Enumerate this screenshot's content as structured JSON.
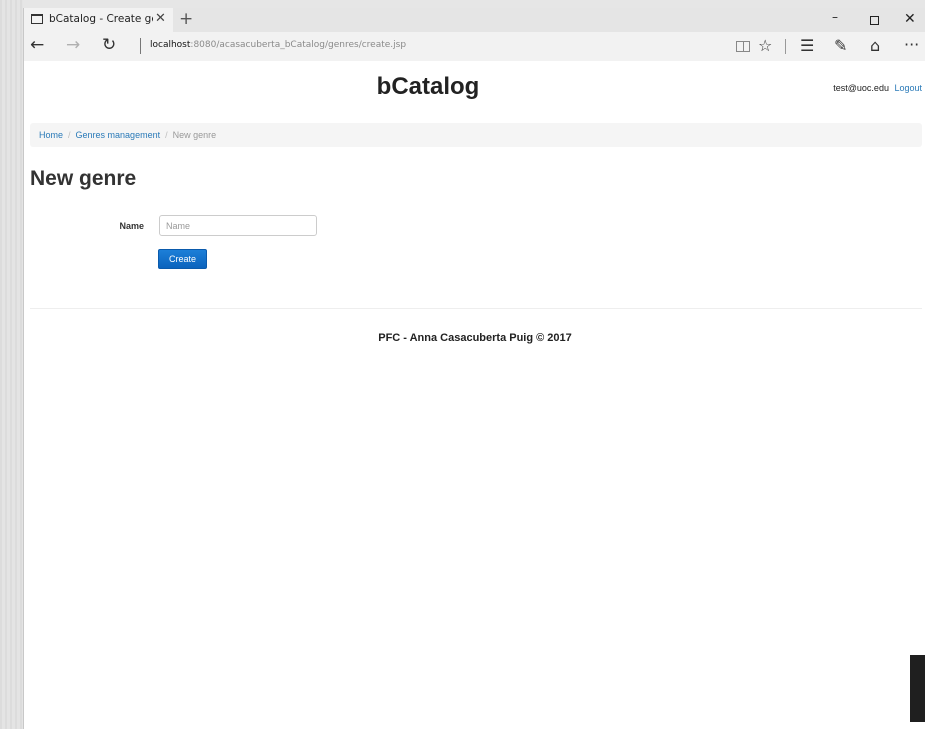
{
  "browser": {
    "tab": {
      "title": "bCatalog - Create genre",
      "close_glyph": "✕",
      "icon": "page-icon"
    },
    "new_tab_glyph": "+",
    "window_controls": {
      "minimize": "–",
      "close": "✕"
    },
    "nav": {
      "back": "←",
      "forward": "→",
      "refresh": "↻"
    },
    "url": {
      "host": "localhost",
      "path": ":8080/acasacuberta_bCatalog/genres/create.jsp"
    },
    "toolbar": {
      "favorite": "☆",
      "hub": "☰",
      "note": "✎",
      "share": "⌂",
      "more": "···"
    }
  },
  "header": {
    "brand": "bCatalog",
    "user_email": "test@uoc.edu",
    "logout_label": "Logout"
  },
  "breadcrumb": {
    "home": "Home",
    "separator": "/",
    "genres": "Genres management",
    "current": "New genre"
  },
  "main": {
    "title": "New genre",
    "form": {
      "name_label": "Name",
      "name_value": "",
      "name_placeholder": "Name",
      "create_label": "Create"
    }
  },
  "footer": {
    "text": "PFC - Anna Casacuberta Puig © 2017"
  },
  "colors": {
    "link": "#2a7ab8",
    "primary_button": "#0b63bd",
    "breadcrumb_bg": "#f5f5f5"
  }
}
